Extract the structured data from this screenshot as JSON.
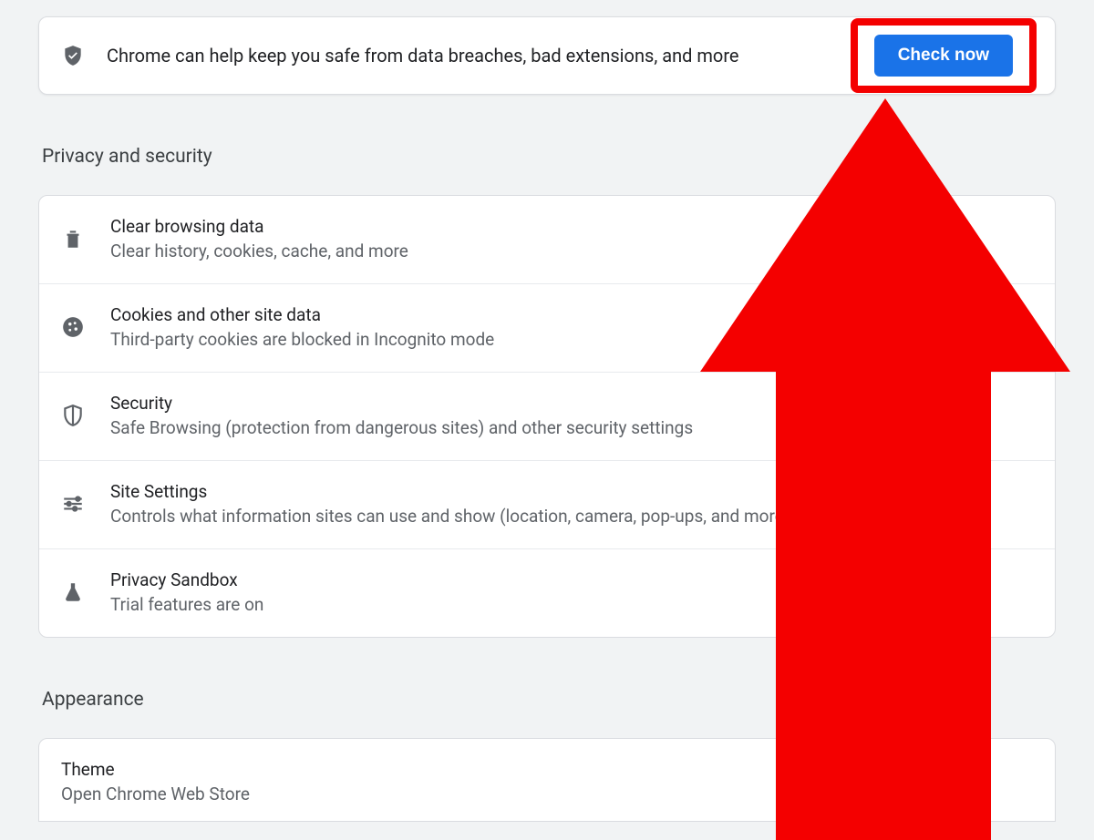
{
  "safety": {
    "message": "Chrome can help keep you safe from data breaches, bad extensions, and more",
    "button_label": "Check now"
  },
  "sections": {
    "privacy_title": "Privacy and security",
    "appearance_title": "Appearance"
  },
  "privacy_items": [
    {
      "icon": "trash-icon",
      "title": "Clear browsing data",
      "subtitle": "Clear history, cookies, cache, and more"
    },
    {
      "icon": "cookie-icon",
      "title": "Cookies and other site data",
      "subtitle": "Third-party cookies are blocked in Incognito mode"
    },
    {
      "icon": "shield-outline-icon",
      "title": "Security",
      "subtitle": "Safe Browsing (protection from dangerous sites) and other security settings"
    },
    {
      "icon": "sliders-icon",
      "title": "Site Settings",
      "subtitle": "Controls what information sites can use and show (location, camera, pop-ups, and more)"
    },
    {
      "icon": "flask-icon",
      "title": "Privacy Sandbox",
      "subtitle": "Trial features are on"
    }
  ],
  "appearance": {
    "theme_title": "Theme",
    "theme_subtitle": "Open Chrome Web Store"
  },
  "colors": {
    "accent": "#1a73e8",
    "annotation_red": "#f40000"
  }
}
